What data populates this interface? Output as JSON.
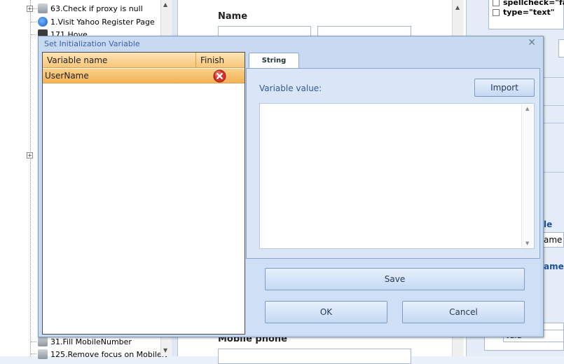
{
  "tree": {
    "items": [
      {
        "label": "63.Check if proxy is null",
        "icon": "script-icon"
      },
      {
        "label": "1.Visit Yahoo Register Page",
        "icon": "globe-icon"
      },
      {
        "label": "171.Hove",
        "icon": "mouse-icon"
      },
      {
        "label": "31.Fill MobileNumber",
        "icon": "input-icon"
      },
      {
        "label": "125.Remove focus on MobileN",
        "icon": "focus-icon"
      }
    ]
  },
  "form": {
    "name_label": "Name",
    "mobile_label": "Mobile phone"
  },
  "right_panel": {
    "attr_1": "spellcheck=\"fa",
    "attr_2": "type=\"text\"",
    "label_le": "le",
    "value_ame": "ame",
    "label_ame": "ame:",
    "value_bottom": "Valu"
  },
  "dialog": {
    "title": "Set Initialization Variable",
    "close_glyph": "✕",
    "columns": {
      "name": "Variable name",
      "finish": "Finish"
    },
    "rows": [
      {
        "name": "UserName"
      }
    ],
    "tab_label": "String",
    "value_label": "Variable value:",
    "value_text": "",
    "import_label": "Import",
    "save_label": "Save",
    "ok_label": "OK",
    "cancel_label": "Cancel"
  },
  "colors": {
    "header_orange": "#f7c679",
    "row_selected": "#f4b255",
    "dialog_bg": "#c8daf2",
    "delete_red": "#d9302b",
    "title_blue": "#3a62a8"
  }
}
